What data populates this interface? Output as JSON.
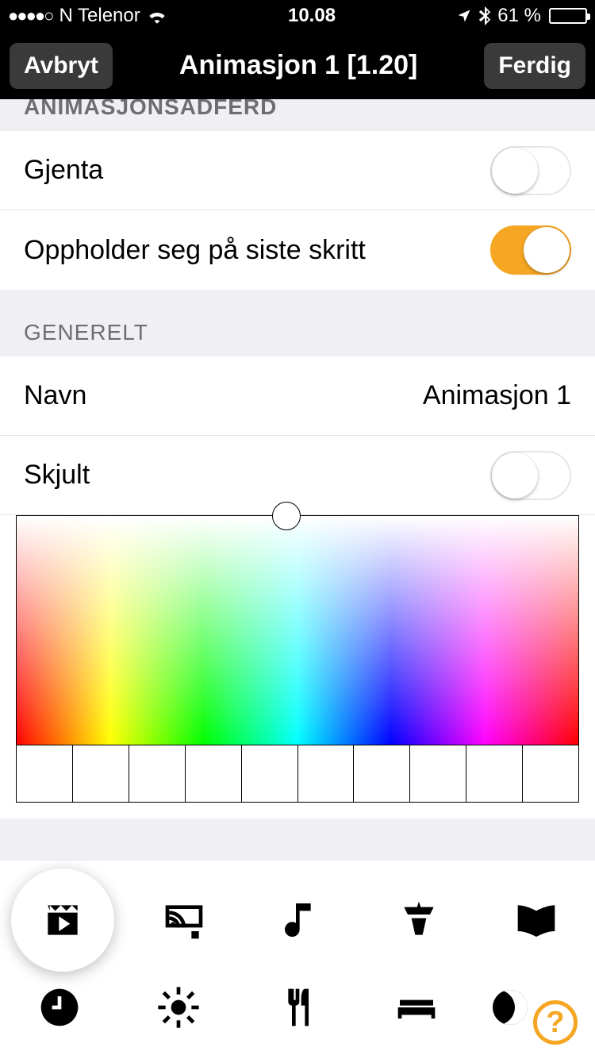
{
  "status": {
    "carrier": "N Telenor",
    "time": "10.08",
    "battery_pct": "61 %"
  },
  "nav": {
    "cancel": "Avbryt",
    "title": "Animasjon 1 [1.20]",
    "done": "Ferdig"
  },
  "sections": {
    "behavior": {
      "header": "ANIMASJONSADFERD",
      "repeat_label": "Gjenta",
      "repeat_on": false,
      "hold_label": "Oppholder seg på siste skritt",
      "hold_on": true
    },
    "general": {
      "header": "GENERELT",
      "name_label": "Navn",
      "name_value": "Animasjon 1",
      "hidden_label": "Skjult",
      "hidden_on": false
    }
  },
  "tabs": {
    "row1": [
      "animation",
      "cast",
      "music",
      "podium",
      "book"
    ],
    "row2": [
      "clock",
      "brightness",
      "dining",
      "bed",
      "night"
    ],
    "selected": "animation"
  }
}
